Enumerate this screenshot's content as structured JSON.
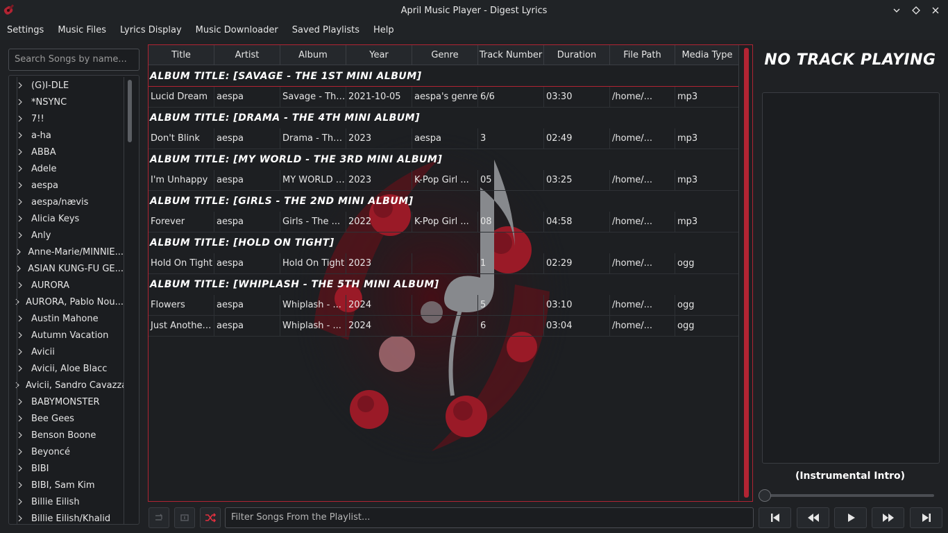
{
  "window": {
    "title": "April Music Player - Digest Lyrics",
    "app_icon": "guitar-icon",
    "controls": [
      "minimize-chevron-icon",
      "maximize-diamond-icon",
      "close-x-icon"
    ]
  },
  "menu": {
    "items": [
      "Settings",
      "Music Files",
      "Lyrics Display",
      "Music Downloader",
      "Saved Playlists",
      "Help"
    ]
  },
  "sidebar": {
    "search_placeholder": "Search Songs by name...",
    "artists": [
      "(G)I-DLE",
      "*NSYNC",
      "7!!",
      "a-ha",
      "ABBA",
      "Adele",
      "aespa",
      "aespa/nævis",
      "Alicia Keys",
      "Anly",
      "Anne-Marie/MINNIE...",
      "ASIAN KUNG-FU GE...",
      "AURORA",
      "AURORA, Pablo Nou...",
      "Austin Mahone",
      "Autumn Vacation",
      "Avicii",
      "Avicii, Aloe Blacc",
      "Avicii, Sandro Cavazza",
      "BABYMONSTER",
      "Bee Gees",
      "Benson Boone",
      "Beyoncé",
      "BIBI",
      "BIBI, Sam Kim",
      "Billie Eilish",
      "Billie Eilish/Khalid"
    ]
  },
  "table": {
    "columns": [
      "Title",
      "Artist",
      "Album",
      "Year",
      "Genre",
      "Track Number",
      "Duration",
      "File Path",
      "Media Type"
    ],
    "groups": [
      {
        "header": "ALBUM TITLE: [SAVAGE - THE 1ST MINI ALBUM]",
        "rows": [
          [
            "Lucid Dream",
            "aespa",
            "Savage - The...",
            "2021-10-05",
            "aespa's genre",
            "6/6",
            "03:30",
            "/home/...",
            "mp3"
          ]
        ]
      },
      {
        "header": "ALBUM TITLE: [DRAMA - THE 4TH MINI ALBUM]",
        "rows": [
          [
            "Don't Blink",
            "aespa",
            "Drama - The...",
            "2023",
            "aespa",
            "3",
            "02:49",
            "/home/...",
            "mp3"
          ]
        ]
      },
      {
        "header": "ALBUM TITLE: [MY WORLD - THE 3RD MINI ALBUM]",
        "rows": [
          [
            "I'm Unhappy",
            "aespa",
            "MY WORLD -...",
            "2023",
            "K-Pop Girl ...",
            "05",
            "03:25",
            "/home/...",
            "mp3"
          ]
        ]
      },
      {
        "header": "ALBUM TITLE: [GIRLS - THE 2ND MINI ALBUM]",
        "rows": [
          [
            "Forever",
            "aespa",
            "Girls - The ...",
            "2022",
            "K-Pop Girl ...",
            "08",
            "04:58",
            "/home/...",
            "mp3"
          ]
        ]
      },
      {
        "header": "ALBUM TITLE: [HOLD ON TIGHT]",
        "rows": [
          [
            "Hold On Tight",
            "aespa",
            "Hold On Tight",
            "2023",
            "",
            "1",
            "02:29",
            "/home/...",
            "ogg"
          ]
        ]
      },
      {
        "header": "ALBUM TITLE: [WHIPLASH - THE 5TH MINI ALBUM]",
        "rows": [
          [
            "Flowers",
            "aespa",
            "Whiplash - ...",
            "2024",
            "",
            "5",
            "03:10",
            "/home/...",
            "ogg"
          ],
          [
            "Just Another...",
            "aespa",
            "Whiplash - ...",
            "2024",
            "",
            "6",
            "03:04",
            "/home/...",
            "ogg"
          ]
        ]
      }
    ],
    "background_art": "red-flowers-music-note-art"
  },
  "bottom_bar": {
    "filter_placeholder": "Filter Songs From the Playlist...",
    "buttons": [
      "repeat-icon",
      "repeat-one-icon",
      "shuffle-icon"
    ]
  },
  "player": {
    "now_playing": "NO TRACK PLAYING",
    "current_lyric": "(Instrumental Intro)",
    "progress": 0,
    "buttons": [
      "skip-previous-icon",
      "rewind-icon",
      "play-icon",
      "fast-forward-icon",
      "skip-next-icon"
    ]
  },
  "colors": {
    "accent": "#b12433",
    "background": "#1f2124",
    "text": "#e6e6e6"
  }
}
